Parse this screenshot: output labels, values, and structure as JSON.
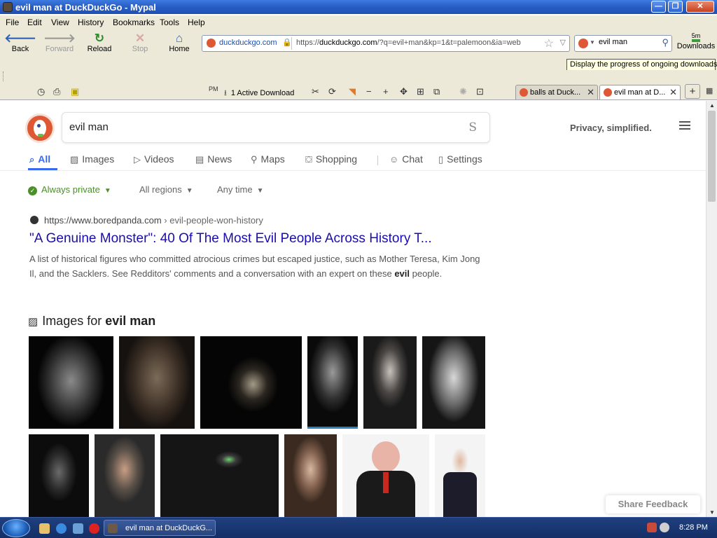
{
  "window": {
    "title": "evil man at DuckDuckGo - Mypal",
    "min": "—",
    "max": "❐",
    "close": "✕"
  },
  "menu": [
    "File",
    "Edit",
    "View",
    "History",
    "Bookmarks",
    "Tools",
    "Help"
  ],
  "nav": {
    "back": "Back",
    "forward": "Forward",
    "reload": "Reload",
    "stop": "Stop",
    "home": "Home"
  },
  "urlbar": {
    "identity": "duckduckgo.com",
    "url_prefix": "https://",
    "url_domain": "duckduckgo.com",
    "url_rest": "/?q=evil+man&kp=1&t=palemoon&ia=web"
  },
  "searchbar": {
    "value": "evil man"
  },
  "downloads": {
    "label": "Downloads",
    "time": "5m",
    "tooltip": "Display the progress of ongoing downloads"
  },
  "active_download": "1 Active Download",
  "tabs": [
    {
      "label": "balls at Duck..."
    },
    {
      "label": "evil man at D..."
    }
  ],
  "ddg": {
    "query": "evil man",
    "clear_glyph": "S",
    "privacy": "Privacy, simplified.",
    "nav": [
      {
        "icon": "⌕",
        "label": "All"
      },
      {
        "icon": "▨",
        "label": "Images"
      },
      {
        "icon": "▷",
        "label": "Videos"
      },
      {
        "icon": "▤",
        "label": "News"
      },
      {
        "icon": "⚲",
        "label": "Maps"
      },
      {
        "icon": "⛋",
        "label": "Shopping"
      },
      {
        "icon": "☺",
        "label": "Chat"
      },
      {
        "icon": "▯",
        "label": "Settings"
      }
    ],
    "filters": [
      "Always private",
      "All regions",
      "Any time"
    ],
    "result": {
      "url": "https://www.boredpanda.com",
      "crumb": "› evil-people-won-history",
      "title": "\"A Genuine Monster\": 40 Of The Most Evil People Across History T...",
      "snippet_pre": "A list of historical figures who committed atrocious crimes but escaped justice, such as Mother Teresa, Kim Jong Il, and the Sacklers. See Redditors' comments and a conversation with an expert on these ",
      "snippet_bold": "evil",
      "snippet_post": " people."
    },
    "images_heading_pre": "Images for ",
    "images_heading_bold": "evil man",
    "feedback": "Share Feedback"
  },
  "taskbar": {
    "item": "evil man at DuckDuckG...",
    "clock": "8:28 PM"
  }
}
